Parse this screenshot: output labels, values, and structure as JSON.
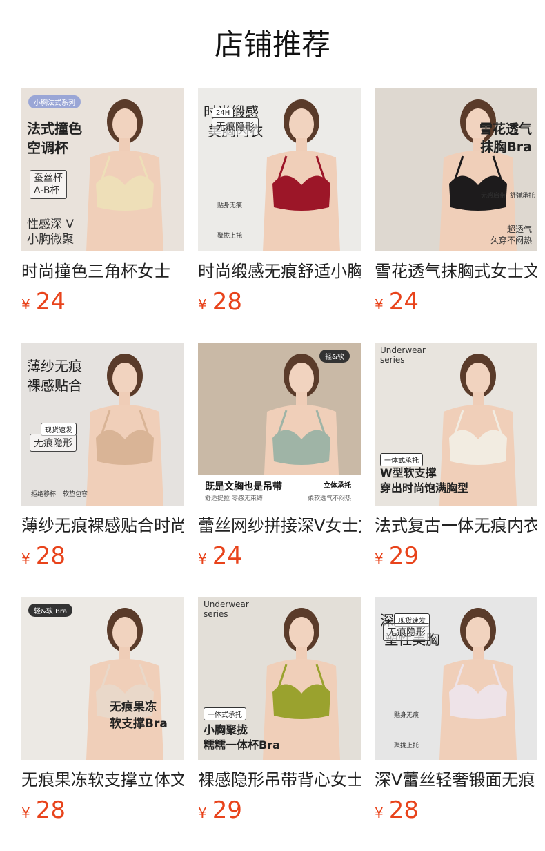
{
  "page_title": "店铺推荐",
  "currency": "¥",
  "products": [
    {
      "name": "时尚撞色三角杯女士",
      "price": "24",
      "tag": "小胸法式系列",
      "headline": "法式撞色\n空调杯",
      "sub_box": "蚕丝杯\nA-B杯",
      "caption": "性感深 V\n小胸微聚",
      "bg": "#e9e2db",
      "bra_color": "#eedfb8"
    },
    {
      "name": "时尚缎感无痕舒适小胸",
      "price": "28",
      "badge": "24H",
      "badge2": "无痕隐形",
      "headline": "时尚缎感\n 美胸内衣",
      "feat1": "贴身无痕",
      "feat2": "聚拢上托",
      "bg": "#ecebe8",
      "bra_color": "#9c1628"
    },
    {
      "name": "雪花透气抹胸式女士文胸",
      "price": "24",
      "headline": "雪花透气\n抹胸Bra",
      "feat1": "无感肩带",
      "feat2": "舒弹承托",
      "caption": "超透气\n久穿不闷热",
      "bg": "#ded8d0",
      "bra_color": "#1d1b1c"
    },
    {
      "name": "薄纱无痕裸感贴合时尚",
      "price": "28",
      "headline": "薄纱无痕\n裸感贴合",
      "badge": "现货速发",
      "badge2": "无痕隐形",
      "feat1": "拒绝移杯",
      "feat2": "软垫包容",
      "bg": "#e5e2df",
      "bra_color": "#d9b496"
    },
    {
      "name": "蕾丝网纱拼接深V女士文胸",
      "price": "24",
      "tag": "轻&软",
      "band_title": "既是文胸也是吊带",
      "band_right": "立体承托",
      "band_sub": "舒适提拉 零感无束缚",
      "band_sub2": "柔软透气不闷热",
      "bg": "#c9b9a6",
      "bra_color": "#9fb4a6"
    },
    {
      "name": "法式复古一体无痕内衣",
      "price": "29",
      "brand": "Underwear\nseries",
      "badge": "一体式承托",
      "headline": "W型软支撑\n穿出时尚饱满胸型",
      "bg": "#e8e4de",
      "bra_color": "#f2ece1"
    },
    {
      "name": "无痕果冻软支撑立体文胸",
      "price": "28",
      "tag": "轻&软 Bra",
      "headline": "无痕果冻\n软支撑Bra",
      "bg": "#ece9e4",
      "bra_color": "#e9d8c9"
    },
    {
      "name": "裸感隐形吊带背心女士",
      "price": "29",
      "brand": "Underwear\nseries",
      "badge": "一体式承托",
      "headline": "小胸聚拢\n糯糯一体杯Bra",
      "bg": "#e3dfd8",
      "bra_color": "#9aa22e"
    },
    {
      "name": "深V蕾丝轻奢锻面无痕",
      "price": "28",
      "badge": "现货速发",
      "badge2": "无痕隐形",
      "headline": "深V蕾丝\n 塑性美胸",
      "feat1": "贴身无痕",
      "feat2": "聚拢上托",
      "bg": "#e6e6e6",
      "bra_color": "#eee3e8"
    }
  ]
}
